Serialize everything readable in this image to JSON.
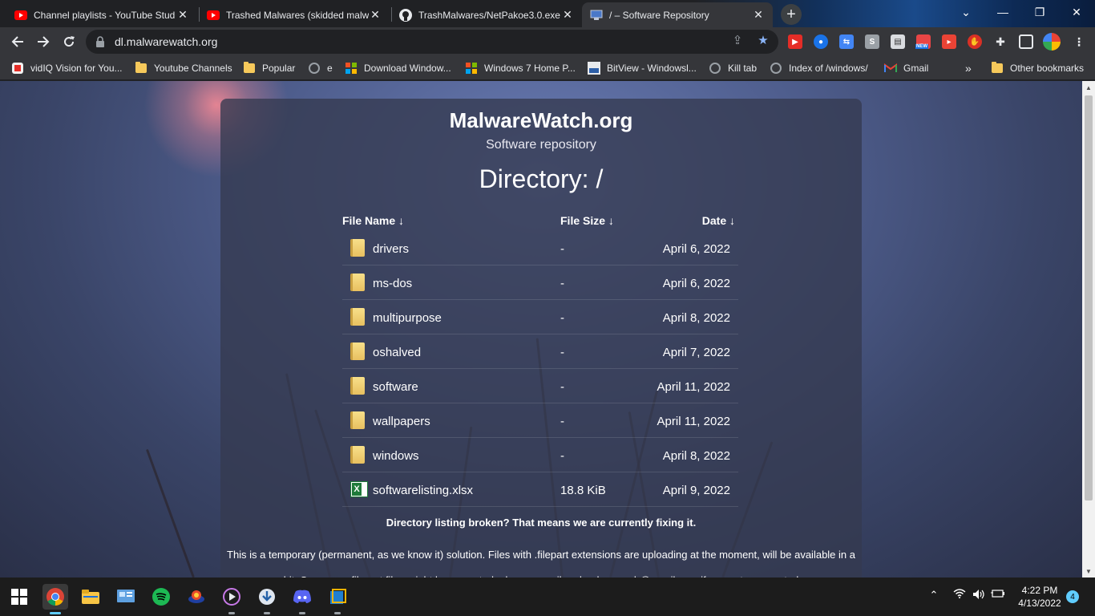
{
  "browser": {
    "tabs": [
      {
        "title": "Channel playlists - YouTube Stud",
        "favicon": "youtube-icon",
        "close": "✕"
      },
      {
        "title": "Trashed Malwares (skidded malw",
        "favicon": "youtube-icon",
        "close": "✕"
      },
      {
        "title": "TrashMalwares/NetPakoe3.0.exe",
        "favicon": "github-icon",
        "close": "✕"
      },
      {
        "title": "/ – Software Repository",
        "favicon": "site-icon",
        "close": "✕"
      }
    ],
    "new_tab": "+",
    "window_controls": {
      "dropdown": "⌄",
      "minimize": "—",
      "maximize": "❐",
      "close": "✕"
    },
    "url": "dl.malwarewatch.org",
    "ext_new_badge": "NEW",
    "bookmarks": [
      {
        "label": "vidIQ Vision for You...",
        "icon": "vidiq-icon"
      },
      {
        "label": "Youtube Channels",
        "icon": "folder-icon"
      },
      {
        "label": "Popular",
        "icon": "folder-icon"
      },
      {
        "label": "e",
        "icon": "globe-icon"
      },
      {
        "label": "Download Window...",
        "icon": "windows-icon"
      },
      {
        "label": "Windows 7 Home P...",
        "icon": "windows-icon"
      },
      {
        "label": "BitView - Windowsl...",
        "icon": "bitview-icon"
      },
      {
        "label": "Kill tab",
        "icon": "globe-icon"
      },
      {
        "label": "Index of /windows/",
        "icon": "globe-icon"
      },
      {
        "label": "Gmail",
        "icon": "gmail-icon"
      }
    ],
    "bookmarks_overflow": "»",
    "other_bookmarks": "Other bookmarks"
  },
  "page": {
    "site_title": "MalwareWatch.org",
    "site_subtitle": "Software repository",
    "directory_title": "Directory: /",
    "columns": {
      "name": "File Name  ↓",
      "size": "File Size  ↓",
      "date": "Date  ↓"
    },
    "files": [
      {
        "name": "drivers",
        "size": "-",
        "date": "April 6, 2022",
        "type": "folder"
      },
      {
        "name": "ms-dos",
        "size": "-",
        "date": "April 6, 2022",
        "type": "folder"
      },
      {
        "name": "multipurpose",
        "size": "-",
        "date": "April 8, 2022",
        "type": "folder"
      },
      {
        "name": "oshalved",
        "size": "-",
        "date": "April 7, 2022",
        "type": "folder"
      },
      {
        "name": "software",
        "size": "-",
        "date": "April 11, 2022",
        "type": "folder"
      },
      {
        "name": "wallpapers",
        "size": "-",
        "date": "April 11, 2022",
        "type": "folder"
      },
      {
        "name": "windows",
        "size": "-",
        "date": "April 8, 2022",
        "type": "folder"
      },
      {
        "name": "softwarelisting.xlsx",
        "size": "18.8 KiB",
        "date": "April 9, 2022",
        "type": "xlsx"
      }
    ],
    "notice_bold": "Directory listing broken? That means we are currently fixing it.",
    "notice": "This is a temporary (permanent, as we know it) solution. Files with .filepart extensions are uploading at the moment, will be available in a bit. Some non-filepart files might be corrupted, please e-mail realendermanch@gmail.com if you get a corrupted"
  },
  "taskbar": {
    "apps": [
      "windows-start-icon",
      "chrome-icon",
      "file-explorer-icon",
      "control-panel-icon",
      "spotify-icon",
      "app-icon",
      "media-player-icon",
      "downloader-icon",
      "discord-icon",
      "virtualbox-icon"
    ],
    "time": "4:22 PM",
    "date": "4/13/2022",
    "notifications": "4"
  }
}
